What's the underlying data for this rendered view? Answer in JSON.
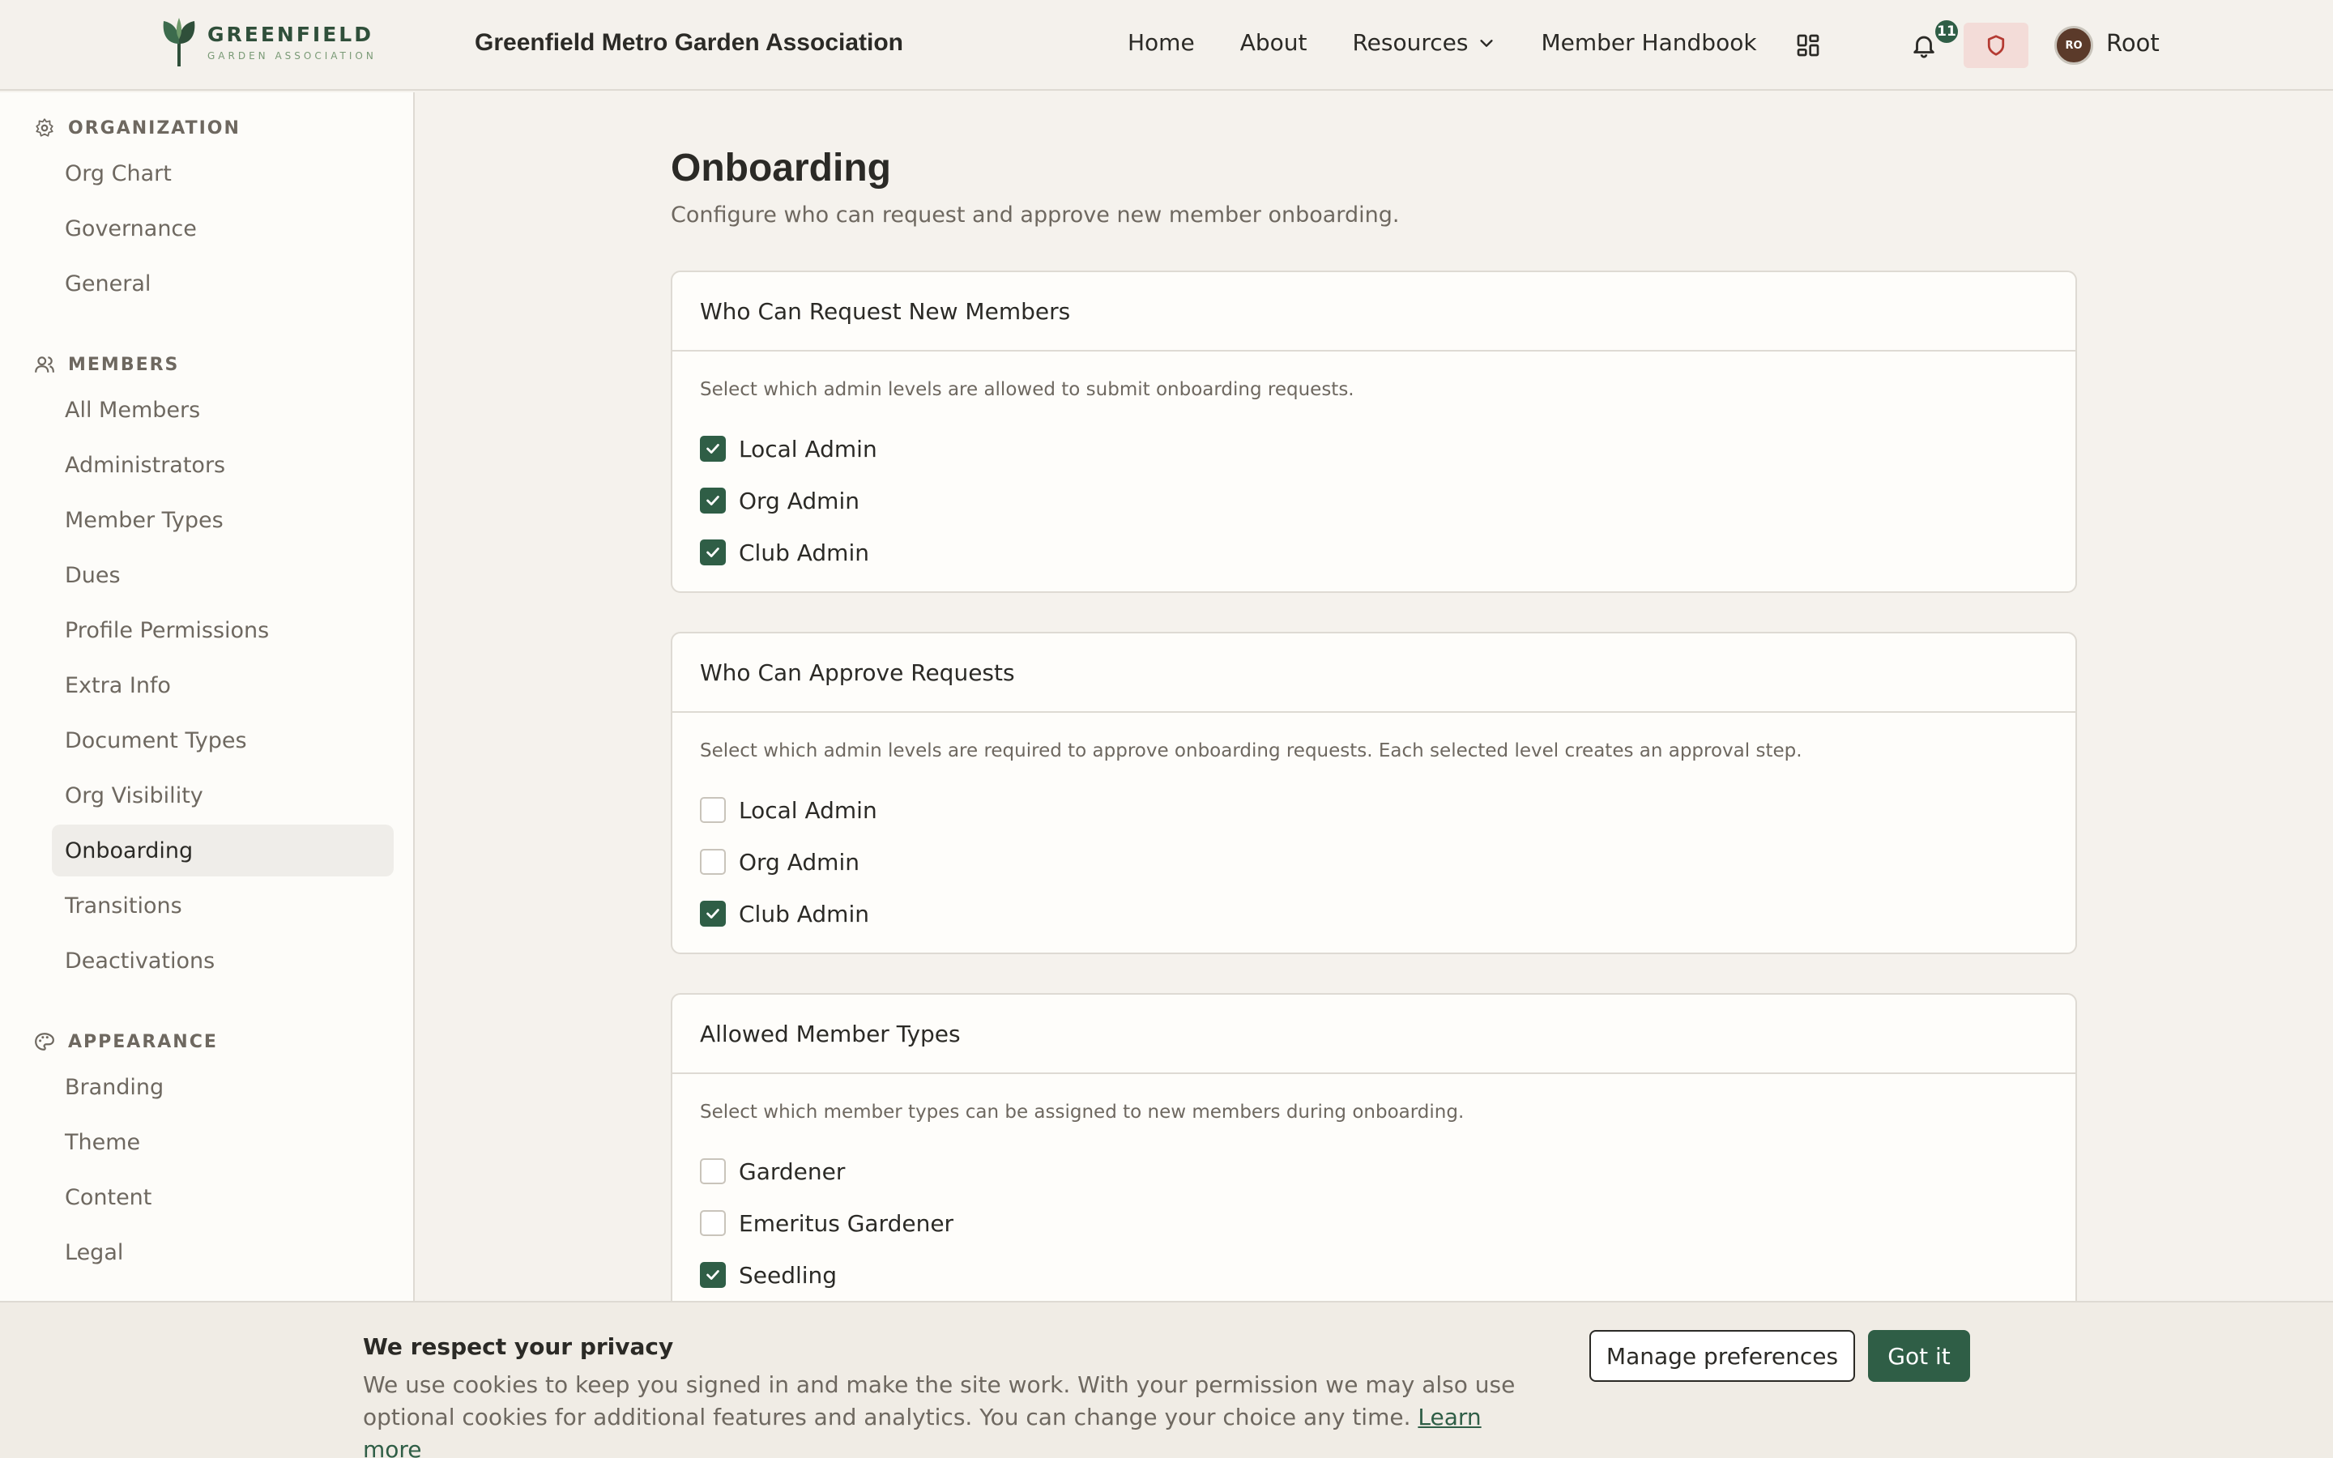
{
  "header": {
    "logo_name": "GREENFIELD",
    "logo_sub": "GARDEN ASSOCIATION",
    "site_title": "Greenfield Metro Garden Association",
    "nav": {
      "home": "Home",
      "about": "About",
      "resources": "Resources",
      "handbook": "Member Handbook"
    },
    "notification_count": "11",
    "avatar_initials": "RO",
    "user_name": "Root"
  },
  "sidebar": {
    "organization": {
      "heading": "ORGANIZATION",
      "items": [
        "Org Chart",
        "Governance",
        "General"
      ]
    },
    "members": {
      "heading": "MEMBERS",
      "items": [
        "All Members",
        "Administrators",
        "Member Types",
        "Dues",
        "Profile Permissions",
        "Extra Info",
        "Document Types",
        "Org Visibility",
        "Onboarding",
        "Transitions",
        "Deactivations"
      ]
    },
    "appearance": {
      "heading": "APPEARANCE",
      "items": [
        "Branding",
        "Theme",
        "Content",
        "Legal"
      ]
    },
    "active_item": "Onboarding"
  },
  "main": {
    "title": "Onboarding",
    "subtitle": "Configure who can request and approve new member onboarding.",
    "cards": [
      {
        "title": "Who Can Request New Members",
        "description": "Select which admin levels are allowed to submit onboarding requests.",
        "options": [
          {
            "label": "Local Admin",
            "checked": true
          },
          {
            "label": "Org Admin",
            "checked": true
          },
          {
            "label": "Club Admin",
            "checked": true
          }
        ]
      },
      {
        "title": "Who Can Approve Requests",
        "description": "Select which admin levels are required to approve onboarding requests. Each selected level creates an approval step.",
        "options": [
          {
            "label": "Local Admin",
            "checked": false
          },
          {
            "label": "Org Admin",
            "checked": false
          },
          {
            "label": "Club Admin",
            "checked": true
          }
        ]
      },
      {
        "title": "Allowed Member Types",
        "description": "Select which member types can be assigned to new members during onboarding.",
        "options": [
          {
            "label": "Gardener",
            "checked": false
          },
          {
            "label": "Emeritus Gardener",
            "checked": false
          },
          {
            "label": "Seedling",
            "checked": true
          }
        ]
      }
    ]
  },
  "cookie": {
    "title": "We respect your privacy",
    "text": "We use cookies to keep you signed in and make the site work. With your permission we may also use optional cookies for additional features and analytics. You can change your choice any time.",
    "learn_more": "Learn more",
    "manage_label": "Manage preferences",
    "accept_label": "Got it"
  },
  "colors": {
    "brand_green": "#2f5e46",
    "background": "#f5f2ed",
    "alert_tint": "#f3dcd8"
  }
}
